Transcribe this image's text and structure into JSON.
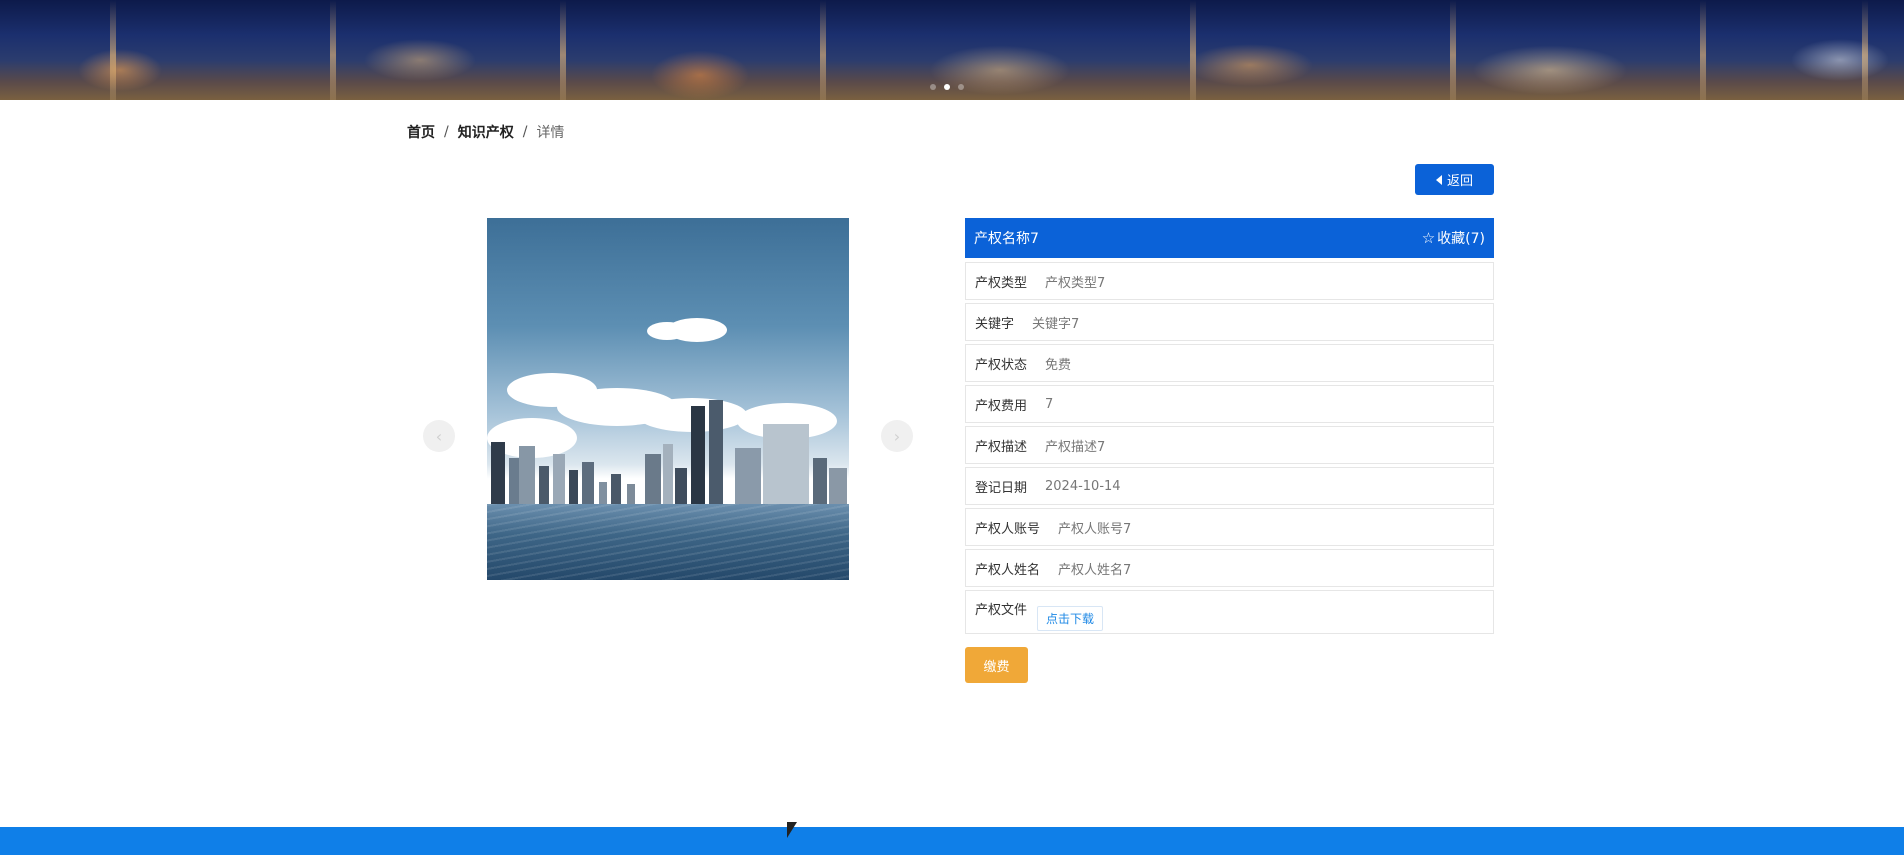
{
  "banner": {
    "slides": [
      "slide-1",
      "slide-2",
      "slide-3"
    ],
    "active_slide": 2
  },
  "breadcrumb": {
    "home": "首页",
    "section": "知识产权",
    "current": "详情",
    "separator": "/"
  },
  "back_button": {
    "label": "返回"
  },
  "gallery": {
    "prev_label": "‹",
    "next_label": "›"
  },
  "detail": {
    "title": "产权名称7",
    "favorite_label": "收藏(7)",
    "rows": [
      {
        "label": "产权类型",
        "value": "产权类型7"
      },
      {
        "label": "关键字",
        "value": "关键字7"
      },
      {
        "label": "产权状态",
        "value": "免费"
      },
      {
        "label": "产权费用",
        "value": "7"
      },
      {
        "label": "产权描述",
        "value": "产权描述7"
      },
      {
        "label": "登记日期",
        "value": "2024-10-14"
      },
      {
        "label": "产权人账号",
        "value": "产权人账号7"
      },
      {
        "label": "产权人姓名",
        "value": "产权人姓名7"
      }
    ],
    "file_label": "产权文件",
    "download_label": "点击下载"
  },
  "pay_button": {
    "label": "缴费"
  },
  "colors": {
    "primary": "#0b62d8",
    "accent": "#f0a838",
    "footer": "#0f7fe8"
  }
}
